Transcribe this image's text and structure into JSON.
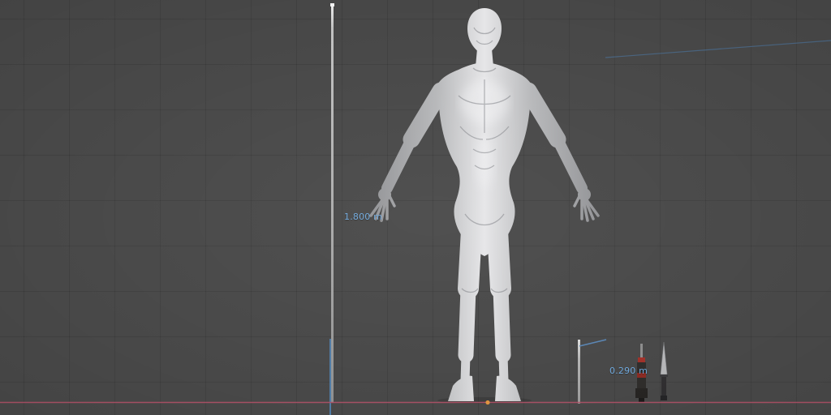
{
  "scene": {
    "app_context": "3d-viewport-orthographic-front",
    "background_color": "#474747",
    "grid_color": "rgba(0,0,0,0.10)",
    "axis_x_color": "#b15067",
    "axis_z_color": "#4f7fae",
    "cursor_color": "#e09340",
    "measurement_color": "#6fa8dc",
    "model_base_color": "#c9cacc"
  },
  "measurements": [
    {
      "id": "figure-height",
      "label": "1.800 m"
    },
    {
      "id": "prop-height",
      "label": "0.290 m"
    }
  ],
  "objects": {
    "figure": "humanoid-character-model",
    "tall_reference": "height-reference-plane",
    "short_reference": "prop-height-reference-plane",
    "prop_left": "hilt-prop",
    "prop_right": "dagger-prop"
  }
}
